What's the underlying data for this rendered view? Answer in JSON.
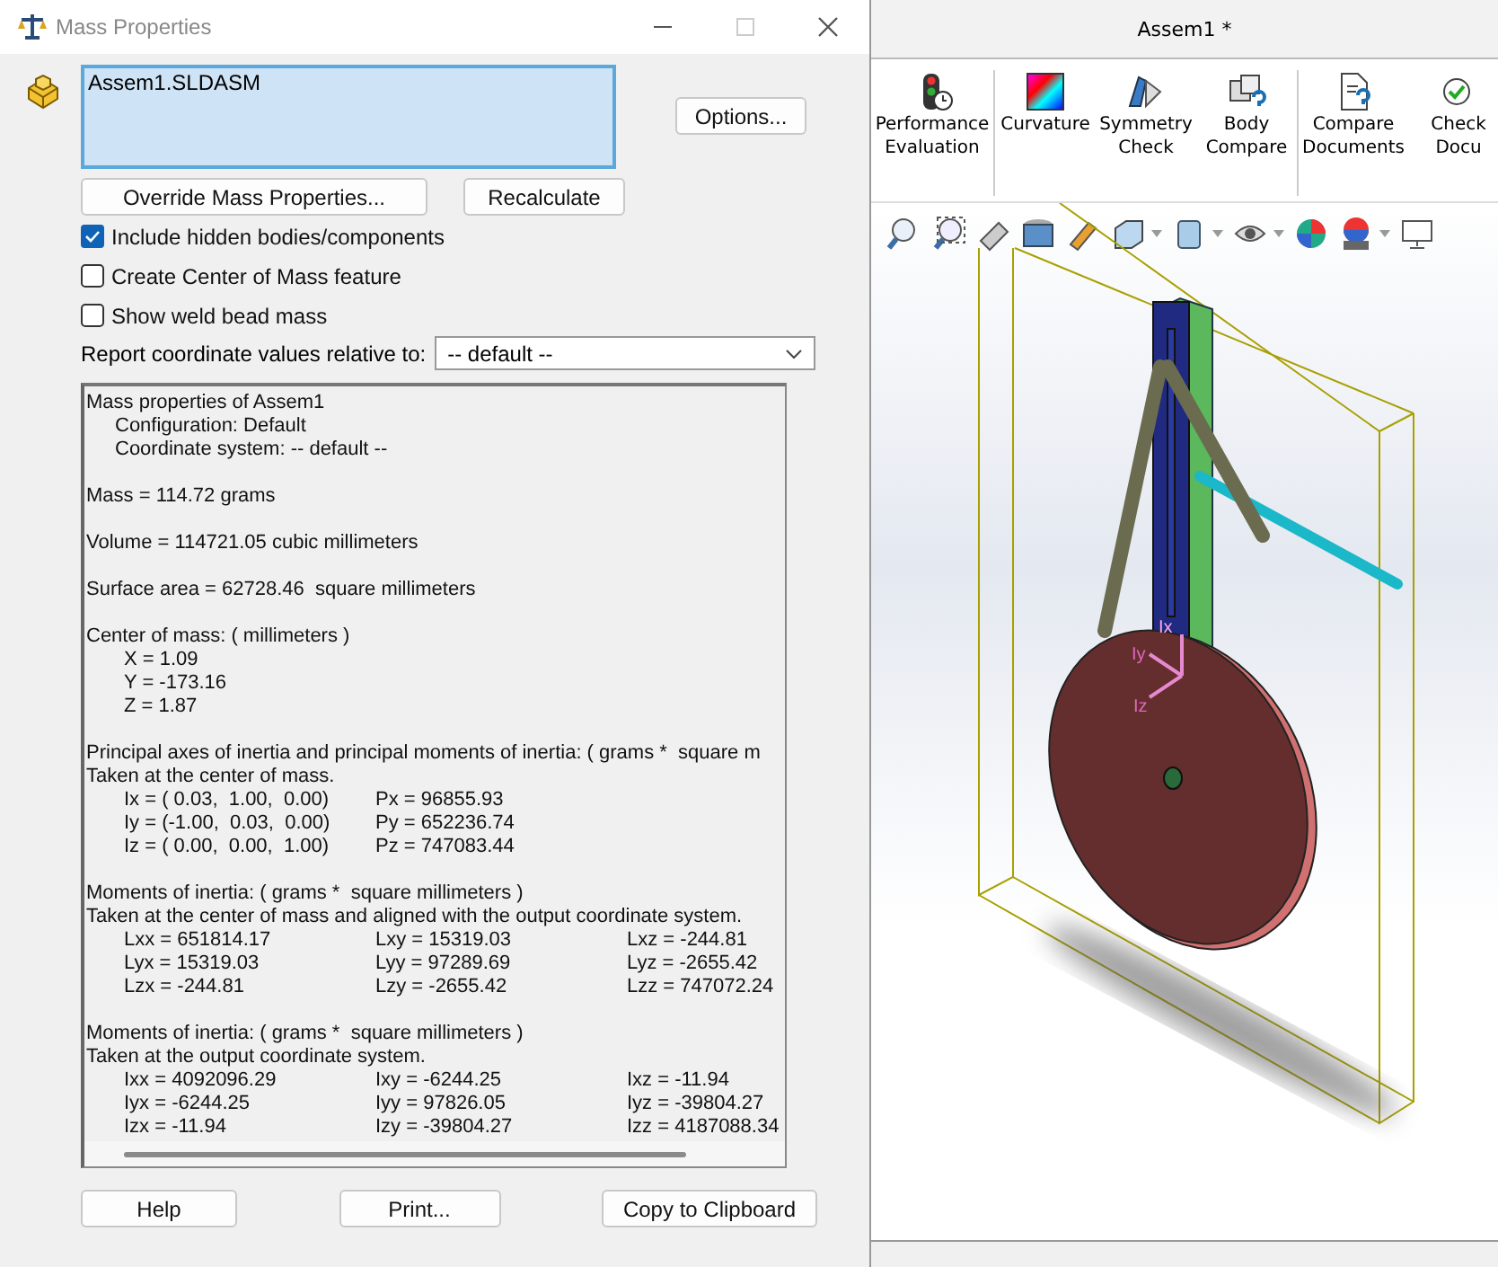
{
  "dialog": {
    "title": "Mass Properties",
    "selection_list": {
      "items": [
        "Assem1.SLDASM"
      ]
    },
    "options_button": "Options...",
    "override_button": "Override Mass Properties...",
    "recalculate_button": "Recalculate",
    "checkboxes": [
      {
        "label": "Include hidden bodies/components",
        "checked": true
      },
      {
        "label": "Create Center of Mass feature",
        "checked": false
      },
      {
        "label": "Show weld bead mass",
        "checked": false
      }
    ],
    "coordinate": {
      "label": "Report coordinate values relative to:",
      "value": "-- default --"
    },
    "report": [
      {
        "kind": "line",
        "text": "Mass properties of Assem1"
      },
      {
        "kind": "sub",
        "text": "Configuration: Default"
      },
      {
        "kind": "sub",
        "text": "Coordinate system: -- default --"
      },
      {
        "kind": "gap"
      },
      {
        "kind": "line",
        "text": "Mass = 114.72 grams"
      },
      {
        "kind": "gap"
      },
      {
        "kind": "line",
        "text": "Volume = 114721.05 cubic millimeters"
      },
      {
        "kind": "gap"
      },
      {
        "kind": "line",
        "text": "Surface area = 62728.46  square millimeters"
      },
      {
        "kind": "gap"
      },
      {
        "kind": "line",
        "text": "Center of mass: ( millimeters )"
      },
      {
        "kind": "row",
        "cells": [
          "X = 1.09"
        ]
      },
      {
        "kind": "row",
        "cells": [
          "Y = -173.16"
        ]
      },
      {
        "kind": "row",
        "cells": [
          "Z = 1.87"
        ]
      },
      {
        "kind": "gap"
      },
      {
        "kind": "line",
        "text": "Principal axes of inertia and principal moments of inertia: ( grams *  square m"
      },
      {
        "kind": "line",
        "text": "Taken at the center of mass."
      },
      {
        "kind": "row",
        "cells": [
          "Ix = ( 0.03,  1.00,  0.00)",
          "Px = 96855.93"
        ]
      },
      {
        "kind": "row",
        "cells": [
          "Iy = (-1.00,  0.03,  0.00)",
          "Py = 652236.74"
        ]
      },
      {
        "kind": "row",
        "cells": [
          "Iz = ( 0.00,  0.00,  1.00)",
          "Pz = 747083.44"
        ]
      },
      {
        "kind": "gap"
      },
      {
        "kind": "line",
        "text": "Moments of inertia: ( grams *  square millimeters )"
      },
      {
        "kind": "line",
        "text": "Taken at the center of mass and aligned with the output coordinate system."
      },
      {
        "kind": "row",
        "cells": [
          "Lxx = 651814.17",
          "Lxy = 15319.03",
          "Lxz = -244.81"
        ]
      },
      {
        "kind": "row",
        "cells": [
          "Lyx = 15319.03",
          "Lyy = 97289.69",
          "Lyz = -2655.42"
        ]
      },
      {
        "kind": "row",
        "cells": [
          "Lzx = -244.81",
          "Lzy = -2655.42",
          "Lzz = 747072.24"
        ]
      },
      {
        "kind": "gap"
      },
      {
        "kind": "line",
        "text": "Moments of inertia: ( grams *  square millimeters )"
      },
      {
        "kind": "line",
        "text": "Taken at the output coordinate system."
      },
      {
        "kind": "row",
        "cells": [
          "Ixx = 4092096.29",
          "Ixy = -6244.25",
          "Ixz = -11.94"
        ]
      },
      {
        "kind": "row",
        "cells": [
          "Iyx = -6244.25",
          "Iyy = 97826.05",
          "Iyz = -39804.27"
        ]
      },
      {
        "kind": "row",
        "cells": [
          "Izx = -11.94",
          "Izy = -39804.27",
          "Izz = 4187088.34"
        ]
      }
    ],
    "footer_buttons": [
      "Help",
      "Print...",
      "Copy to Clipboard"
    ]
  },
  "app": {
    "title": "Assem1 *",
    "ribbon_groups": [
      [
        {
          "label": "Performance Evaluation"
        }
      ],
      [
        {
          "label": "Curvature"
        },
        {
          "label": "Symmetry Check"
        },
        {
          "label": "Body Compare"
        }
      ],
      [
        {
          "label": "Compare Documents"
        },
        {
          "label": "Check Docu"
        }
      ]
    ],
    "triad_labels": [
      "Ix",
      "Iy",
      "Iz"
    ]
  }
}
